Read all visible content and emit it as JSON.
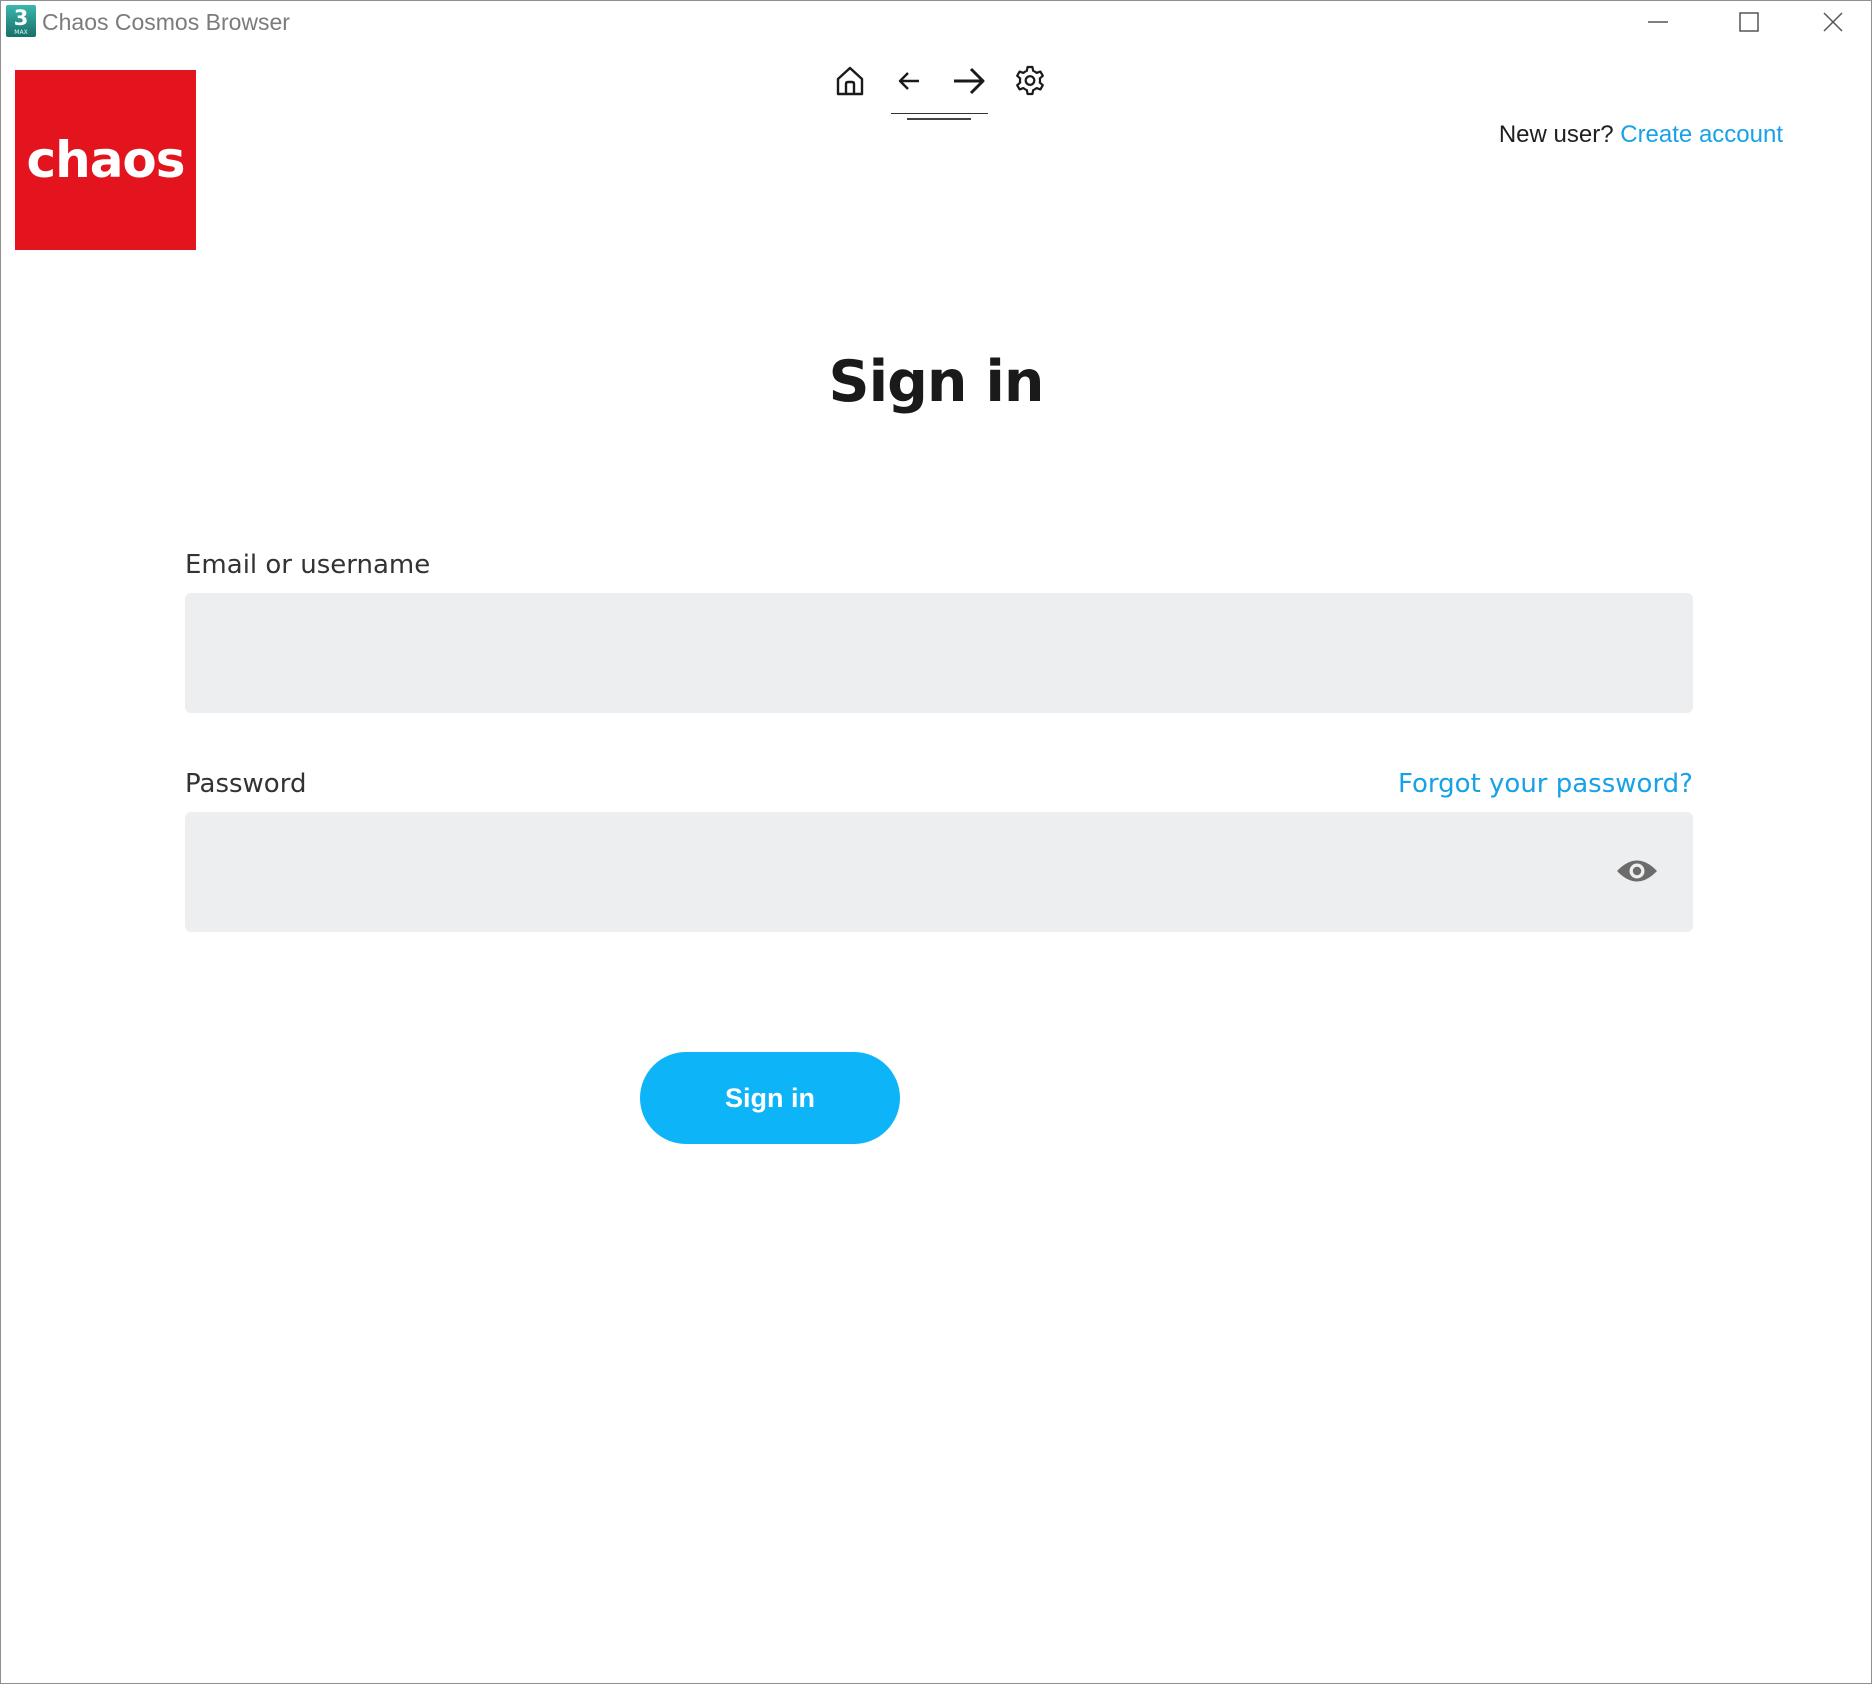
{
  "window": {
    "title": "Chaos Cosmos Browser",
    "app_icon_number": "3",
    "app_icon_subtext": "MAX",
    "controls": {
      "minimize": "minimize-icon",
      "maximize": "maximize-icon",
      "close": "close-icon"
    }
  },
  "logo": {
    "text": "chaos",
    "background": "#e3141e"
  },
  "nav": {
    "icons": [
      "home-icon",
      "arrow-left-icon",
      "arrow-right-icon",
      "gear-icon"
    ]
  },
  "account": {
    "prompt": "New user?",
    "create_link": "Create account"
  },
  "main": {
    "heading": "Sign in"
  },
  "form": {
    "email_label": "Email or username",
    "email_value": "",
    "password_label": "Password",
    "password_value": "",
    "forgot_link": "Forgot your password?",
    "submit_label": "Sign in",
    "eye_icon": "eye-icon"
  },
  "colors": {
    "accent": "#0db4f8",
    "link": "#17a2e8",
    "brand_red": "#e3141e",
    "field_bg": "#edeeef"
  }
}
